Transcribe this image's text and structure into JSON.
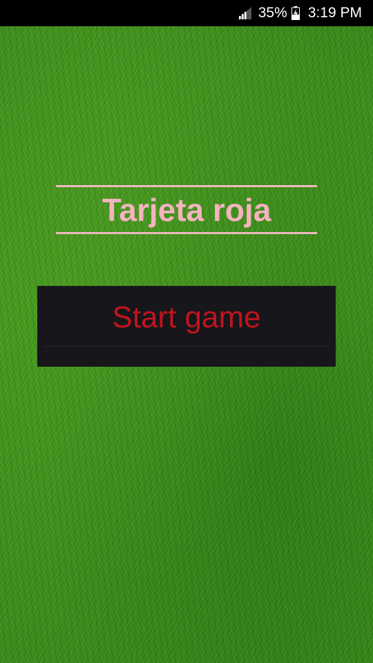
{
  "status_bar": {
    "battery_percent": "35%",
    "time": "3:19 PM",
    "signal_icon": "signal-icon",
    "battery_icon": "battery-charging-icon"
  },
  "main": {
    "title": "Tarjeta roja",
    "start_button_label": "Start game"
  },
  "colors": {
    "title": "#f4b3be",
    "button_bg": "#17161b",
    "button_text": "#c0141c",
    "background": "#3f8f1c"
  }
}
